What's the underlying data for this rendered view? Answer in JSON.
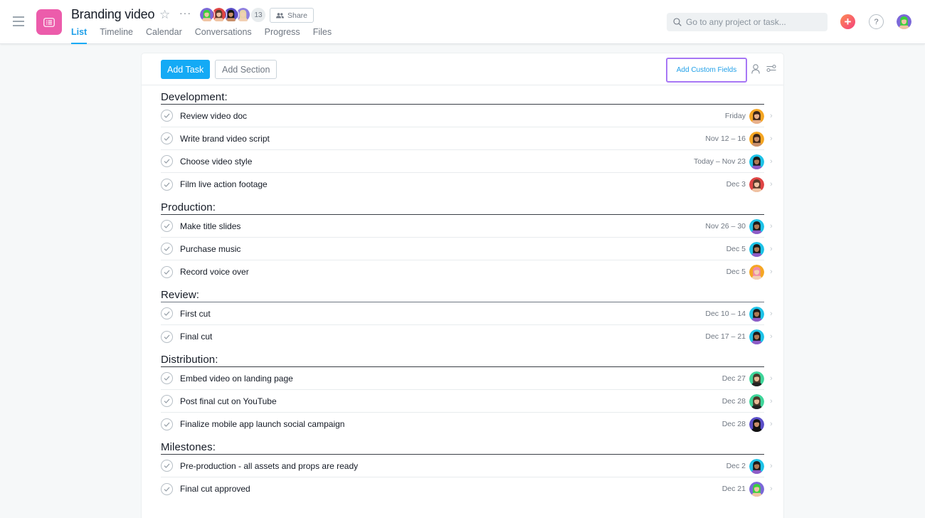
{
  "header": {
    "project_title": "Branding video",
    "member_count": "13",
    "share_label": "Share",
    "members": [
      {
        "name": "member-1",
        "bg": "#7b68d8",
        "hair": "#3ad13a",
        "skin": "#f0c4a4"
      },
      {
        "name": "member-2",
        "bg": "#e04545",
        "hair": "#5a3a2a",
        "skin": "#f0c4a4"
      },
      {
        "name": "member-3",
        "bg": "#5b4fc9",
        "hair": "#111111",
        "skin": "#c98f6a"
      },
      {
        "name": "member-4",
        "bg": "#8e7fe0",
        "hair": "#e6d3a8",
        "skin": "#f2d0b4"
      }
    ],
    "tabs": [
      {
        "label": "List",
        "active": true
      },
      {
        "label": "Timeline",
        "active": false
      },
      {
        "label": "Calendar",
        "active": false
      },
      {
        "label": "Conversations",
        "active": false
      },
      {
        "label": "Progress",
        "active": false
      },
      {
        "label": "Files",
        "active": false
      }
    ],
    "search_placeholder": "Go to any project or task...",
    "help_label": "?",
    "plus_label": "+"
  },
  "colors": {
    "accent_blue": "#14aaf5",
    "project_pink": "#ec5cab",
    "highlight_purple": "#a777f5"
  },
  "toolbar": {
    "add_task_label": "Add Task",
    "add_section_label": "Add Section",
    "add_custom_fields_label": "Add Custom Fields"
  },
  "sections": [
    {
      "title": "Development:",
      "tasks": [
        {
          "name": "Review video doc",
          "due": "Friday",
          "assignee": {
            "bg": "#f5a623",
            "hair": "#3a2418",
            "skin": "#e8b08a"
          }
        },
        {
          "name": "Write brand video script",
          "due": "Nov 12 – 16",
          "assignee": {
            "bg": "#f5a623",
            "hair": "#3a2418",
            "skin": "#c98f6a"
          }
        },
        {
          "name": "Choose video style",
          "due": "Today – Nov 23",
          "assignee": {
            "bg": "#1ec3e8",
            "hair": "#1a1a1a",
            "skin": "#b07a55",
            "shirt": "#8e5cc7"
          }
        },
        {
          "name": "Film live action footage",
          "due": "Dec 3",
          "assignee": {
            "bg": "#e04545",
            "hair": "#5a3a2a",
            "skin": "#f0c4a4"
          }
        }
      ]
    },
    {
      "title": "Production:",
      "tasks": [
        {
          "name": "Make title slides",
          "due": "Nov 26 – 30",
          "assignee": {
            "bg": "#1ec3e8",
            "hair": "#1a1a1a",
            "skin": "#b07a55",
            "shirt": "#8e5cc7"
          }
        },
        {
          "name": "Purchase music",
          "due": "Dec 5",
          "assignee": {
            "bg": "#1ec3e8",
            "hair": "#1a1a1a",
            "skin": "#b07a55",
            "shirt": "#8e5cc7"
          }
        },
        {
          "name": "Record voice over",
          "due": "Dec 5",
          "assignee": {
            "bg": "#f5a623",
            "hair": "#f08aa8",
            "skin": "#f2d0b4"
          }
        }
      ]
    },
    {
      "title": "Review:",
      "tasks": [
        {
          "name": "First cut",
          "due": "Dec 10 – 14",
          "assignee": {
            "bg": "#1ec3e8",
            "hair": "#1a1a1a",
            "skin": "#b07a55",
            "shirt": "#8e5cc7"
          }
        },
        {
          "name": "Final cut",
          "due": "Dec 17 – 21",
          "assignee": {
            "bg": "#1ec3e8",
            "hair": "#1a1a1a",
            "skin": "#b07a55",
            "shirt": "#8e5cc7"
          }
        }
      ]
    },
    {
      "title": "Distribution:",
      "tasks": [
        {
          "name": "Embed video on landing page",
          "due": "Dec 27",
          "assignee": {
            "bg": "#3fd69b",
            "hair": "#4a3a2a",
            "skin": "#e8b896",
            "shirt": "#222222"
          }
        },
        {
          "name": "Post final cut on YouTube",
          "due": "Dec 28",
          "assignee": {
            "bg": "#3fd69b",
            "hair": "#4a3a2a",
            "skin": "#e8b896",
            "shirt": "#222222"
          }
        },
        {
          "name": "Finalize mobile app launch social campaign",
          "due": "Dec 28",
          "assignee": {
            "bg": "#5b4fc9",
            "hair": "#111111",
            "skin": "#c98f6a",
            "shirt": "#111111"
          }
        }
      ]
    },
    {
      "title": "Milestones:",
      "tasks": [
        {
          "name": "Pre-production - all assets and props are ready",
          "due": "Dec 2",
          "assignee": {
            "bg": "#1ec3e8",
            "hair": "#1a1a1a",
            "skin": "#b07a55",
            "shirt": "#8e5cc7"
          }
        },
        {
          "name": "Final cut approved",
          "due": "Dec 21",
          "assignee": {
            "bg": "#7b68d8",
            "hair": "#3ad13a",
            "skin": "#f0c4a4"
          }
        }
      ]
    }
  ]
}
